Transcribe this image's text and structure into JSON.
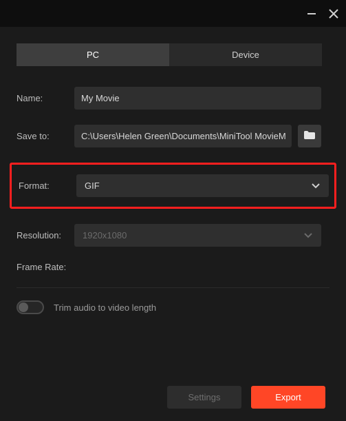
{
  "tabs": {
    "pc": "PC",
    "device": "Device"
  },
  "labels": {
    "name": "Name:",
    "saveTo": "Save to:",
    "format": "Format:",
    "resolution": "Resolution:",
    "frameRate": "Frame Rate:"
  },
  "fields": {
    "name": "My Movie",
    "saveTo": "C:\\Users\\Helen Green\\Documents\\MiniTool MovieM",
    "format": "GIF",
    "resolution": "1920x1080"
  },
  "trim": {
    "label": "Trim audio to video length"
  },
  "footer": {
    "settings": "Settings",
    "export": "Export"
  }
}
